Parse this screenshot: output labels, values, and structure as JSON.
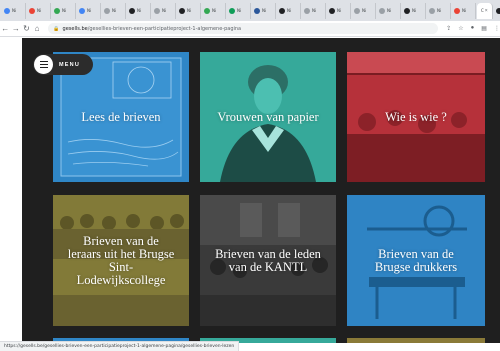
{
  "browser": {
    "tabs": [
      {
        "icon": "globe-icon",
        "color": "#4285f4",
        "label": "Ni"
      },
      {
        "icon": "globe-icon",
        "color": "#ea4335",
        "label": "Ni"
      },
      {
        "icon": "doc-icon",
        "color": "#34a853",
        "label": "Ni"
      },
      {
        "icon": "doc-icon",
        "color": "#4285f4",
        "label": "Ni"
      },
      {
        "icon": "page-icon",
        "color": "#9aa0a6",
        "label": "Ni"
      },
      {
        "icon": "github-icon",
        "color": "#202124",
        "label": "Ni"
      },
      {
        "icon": "page-icon",
        "color": "#9aa0a6",
        "label": "Ni"
      },
      {
        "icon": "github-icon",
        "color": "#202124",
        "label": "Ni"
      },
      {
        "icon": "doc-icon",
        "color": "#34a853",
        "label": "Ni"
      },
      {
        "icon": "doc-icon",
        "color": "#0f9d58",
        "label": "Ni"
      },
      {
        "icon": "word-icon",
        "color": "#2b579a",
        "label": "Ni"
      },
      {
        "icon": "github-icon",
        "color": "#202124",
        "label": "Ni"
      },
      {
        "icon": "page-icon",
        "color": "#9aa0a6",
        "label": "Ni"
      },
      {
        "icon": "github-icon",
        "color": "#202124",
        "label": "Ni"
      },
      {
        "icon": "page-icon",
        "color": "#9aa0a6",
        "label": "Ni"
      },
      {
        "icon": "page-icon",
        "color": "#9aa0a6",
        "label": "Ni"
      },
      {
        "icon": "github-icon",
        "color": "#202124",
        "label": "Ni"
      },
      {
        "icon": "page-icon",
        "color": "#9aa0a6",
        "label": "Ni"
      },
      {
        "icon": "page-icon",
        "color": "#ea4335",
        "label": "Ni"
      }
    ],
    "active_tab": {
      "label": "C",
      "close": "×"
    },
    "tabs_after": [
      {
        "icon": "github-icon",
        "color": "#202124",
        "label": "Ni"
      },
      {
        "icon": "page-icon",
        "color": "#9aa0a6",
        "label": "Ni"
      },
      {
        "icon": "github-icon",
        "color": "#202124",
        "label": "Ni"
      },
      {
        "icon": "doc-icon",
        "color": "#34a853",
        "label": "Ni"
      }
    ],
    "new_tab": "+",
    "url_host": "gesells.be",
    "url_path": "/gesellies-brieven-een-participatieproject-1-algemene-pagina",
    "status_url": "https://gesells.be/gesellies-brieven-een-participatieproject-1-algemene-pagina/gesellies-brieven-lezen"
  },
  "menu": {
    "label": "MENU"
  },
  "tiles": [
    {
      "title": "Lees de brieven"
    },
    {
      "title": "Vrouwen van papier"
    },
    {
      "title": "Wie is wie ?"
    },
    {
      "title": "Brieven van de leraars uit het Brugse Sint-Lodewijkscollege"
    },
    {
      "title": "Brieven van de leden van de KANTL"
    },
    {
      "title": "Brieven van de Brugse drukkers"
    }
  ]
}
